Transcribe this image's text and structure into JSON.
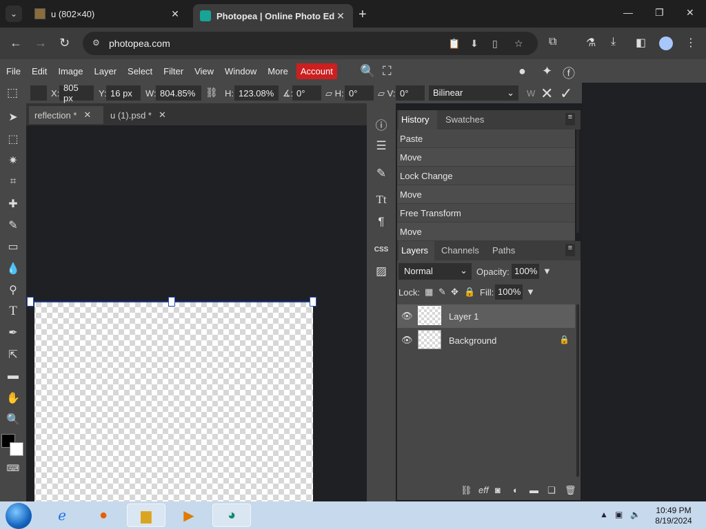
{
  "browser": {
    "tabs": [
      {
        "title": "u (802×40)",
        "active": false
      },
      {
        "title": "Photopea | Online Photo Editor",
        "active": true
      }
    ],
    "address": "photopea.com"
  },
  "menu": {
    "items": [
      "File",
      "Edit",
      "Image",
      "Layer",
      "Select",
      "Filter",
      "View",
      "Window",
      "More"
    ],
    "account": "Account"
  },
  "options": {
    "x_label": "X:",
    "x_value": "805 px",
    "y_label": "Y:",
    "y_value": "16 px",
    "w_label": "W:",
    "w_value": "804.85%",
    "h_label": "H:",
    "h_value": "123.08%",
    "angle_label": "∡:",
    "angle_value": "0°",
    "skew_h_label": "▱ H:",
    "skew_h_value": "0°",
    "skew_v_label": "▱ V:",
    "skew_v_value": "0°",
    "interpolation": "Bilinear",
    "w_cut": "W"
  },
  "documents": [
    {
      "name": "reflection *",
      "active": true
    },
    {
      "name": "u (1).psd *",
      "active": false
    }
  ],
  "history": {
    "tabs": [
      "History",
      "Swatches"
    ],
    "items": [
      "Paste",
      "Move",
      "Lock Change",
      "Move",
      "Free Transform",
      "Move"
    ]
  },
  "layers": {
    "tabs": [
      "Layers",
      "Channels",
      "Paths"
    ],
    "blend_mode": "Normal",
    "opacity_label": "Opacity:",
    "opacity": "100%",
    "lock_label": "Lock:",
    "fill_label": "Fill:",
    "fill": "100%",
    "items": [
      {
        "name": "Layer 1",
        "selected": true,
        "locked": false
      },
      {
        "name": "Background",
        "selected": false,
        "locked": true
      }
    ]
  },
  "strip": {
    "css_label": "CSS"
  },
  "taskbar": {
    "time": "10:49 PM",
    "date": "8/19/2024"
  },
  "colors": {
    "accent_account": "#cc1f1f",
    "panel_bg": "#474747",
    "canvas_bg": "#1f2023",
    "transform_handle": "#2a50b4"
  }
}
